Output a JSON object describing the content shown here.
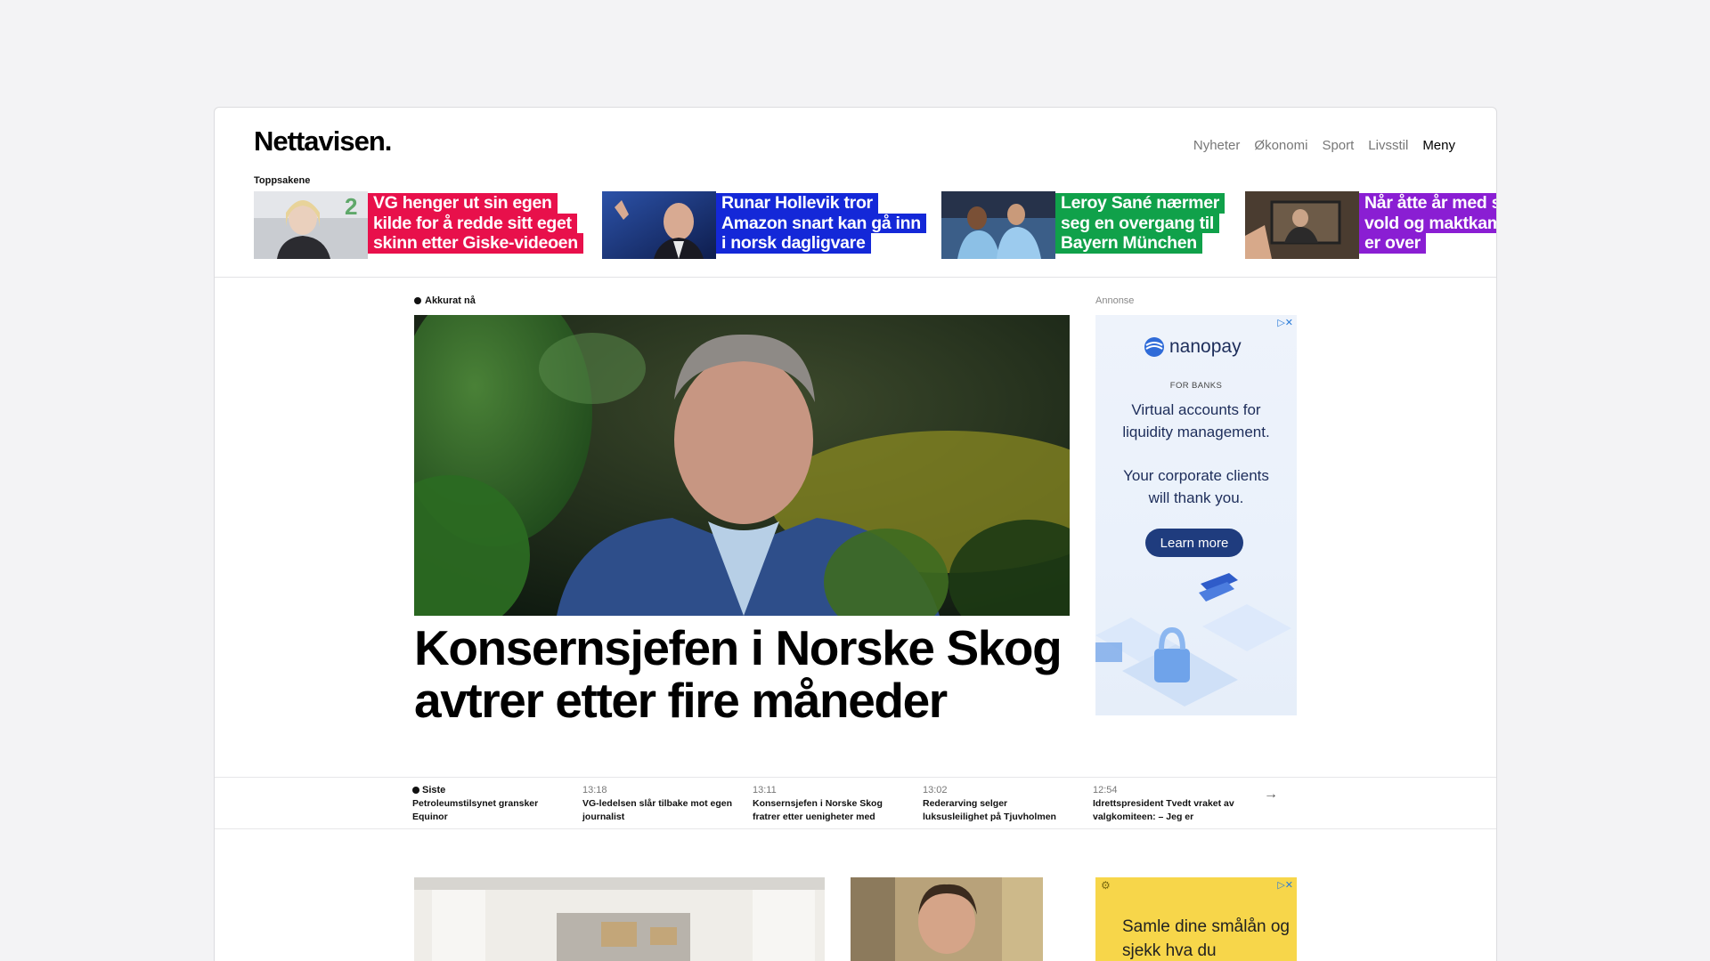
{
  "header": {
    "logo": "Nettavisen.",
    "nav": [
      "Nyheter",
      "Økonomi",
      "Sport",
      "Livsstil"
    ],
    "menu": "Meny"
  },
  "toppsakene": {
    "label": "Toppsakene",
    "items": [
      {
        "lines": [
          "VG henger ut sin egen",
          "kilde for å redde sitt eget",
          "skinn etter Giske-videoen"
        ],
        "color": "#e8104b"
      },
      {
        "lines": [
          "Runar Hollevik tror",
          "Amazon snart kan gå inn",
          "i norsk dagligvare"
        ],
        "color": "#1428d8"
      },
      {
        "lines": [
          "Leroy Sané nærmer",
          "seg en overgang til",
          "Bayern München"
        ],
        "color": "#10a14a"
      },
      {
        "lines": [
          "Når åtte år med s",
          "vold og maktkam",
          "er over"
        ],
        "color": "#8a1ed3"
      }
    ]
  },
  "main": {
    "live_label": "Akkurat nå",
    "headline": "Konsernsjefen i Norske Skog avtrer etter fire måneder"
  },
  "ad": {
    "label": "Annonse",
    "brand": "nanopay",
    "for": "FOR BANKS",
    "headline": "Virtual accounts for liquidity management.",
    "sub": "Your corporate clients will thank you.",
    "cta": "Learn more"
  },
  "latest": {
    "items": [
      {
        "time": "Siste",
        "text": "Petroleumstilsynet gransker Equinor"
      },
      {
        "time": "13:18",
        "text": "VG-ledelsen slår tilbake mot egen journalist"
      },
      {
        "time": "13:11",
        "text": "Konsernsjefen i Norske Skog fratrer etter uenigheter med"
      },
      {
        "time": "13:02",
        "text": "Rederarving selger luksusleilighet på Tjuvholmen"
      },
      {
        "time": "12:54",
        "text": "Idrettspresident Tvedt vraket av valgkomiteen: – Jeg er"
      }
    ]
  },
  "ad2": {
    "text": "Samle dine smålån og sjekk hva du"
  }
}
